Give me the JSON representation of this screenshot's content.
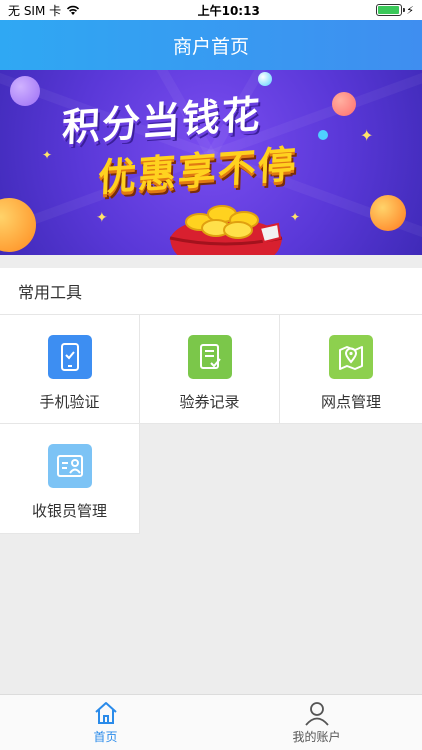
{
  "status_bar": {
    "carrier": "无 SIM 卡",
    "time": "上午10:13",
    "battery_level": 0.95
  },
  "navbar": {
    "title": "商户首页"
  },
  "banner": {
    "line1": "积分当钱花",
    "line2": "优惠享不停"
  },
  "tools_section": {
    "title": "常用工具",
    "items": [
      {
        "label": "手机验证",
        "icon": "phone-verify-icon",
        "color": "#3d8ef2"
      },
      {
        "label": "验券记录",
        "icon": "coupon-record-icon",
        "color": "#7bc74a"
      },
      {
        "label": "网点管理",
        "icon": "map-pin-icon",
        "color": "#8dd04e"
      },
      {
        "label": "收银员管理",
        "icon": "cashier-id-icon",
        "color": "#7cc3f5"
      }
    ]
  },
  "tab_bar": {
    "tabs": [
      {
        "label": "首页",
        "icon": "home-icon",
        "active": true
      },
      {
        "label": "我的账户",
        "icon": "user-icon",
        "active": false
      }
    ]
  },
  "colors": {
    "accent": "#2a8bea",
    "background": "#ededed"
  }
}
